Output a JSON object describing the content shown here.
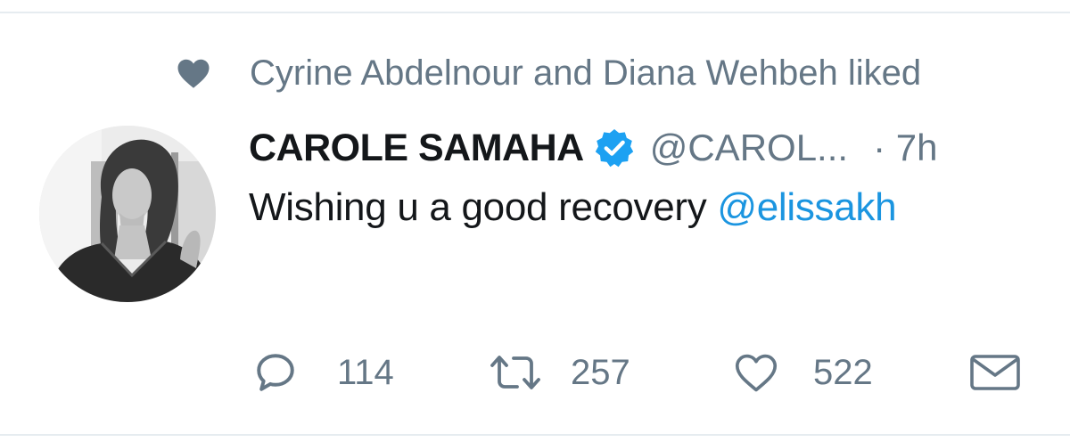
{
  "social_context": {
    "icon": "heart-icon",
    "text": "Cyrine Abdelnour and Diana Wehbeh liked"
  },
  "tweet": {
    "avatar_icon": "profile-photo",
    "display_name": "CAROLE SAMAHA",
    "verified_icon": "verified-badge-icon",
    "handle": "@CAROL...",
    "time": "· 7h",
    "text_before": "Wishing u a good recovery ",
    "mention": "@elissakh"
  },
  "actions": {
    "reply": {
      "icon": "reply-icon",
      "count": "114"
    },
    "retweet": {
      "icon": "retweet-icon",
      "count": "257"
    },
    "like": {
      "icon": "heart-outline-icon",
      "count": "522"
    },
    "direct_message": {
      "icon": "envelope-icon"
    }
  },
  "colors": {
    "primary_text": "#14171a",
    "secondary_text": "#657786",
    "link": "#1b95e0",
    "verified": "#1da1f2",
    "divider": "#e6ecf0"
  }
}
